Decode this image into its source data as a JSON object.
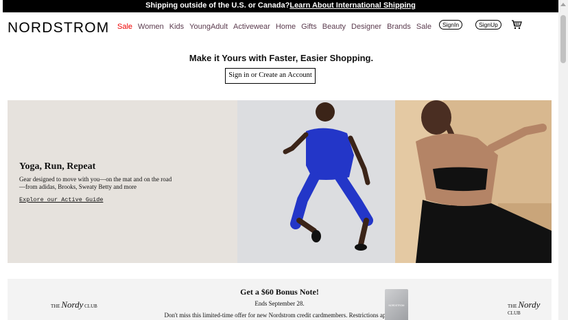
{
  "banner": {
    "text": "Shipping outside of the U.S. or Canada?",
    "link": "Learn About International Shipping"
  },
  "header": {
    "logo": "NORDSTROM",
    "nav": [
      "Sale",
      "Women",
      "Kids",
      "YoungAdult",
      "Activewear",
      "Home",
      "Gifts",
      "Beauty",
      "Designer",
      "Brands",
      "Sale"
    ],
    "signin": "SignIn",
    "signup": "SignUp",
    "cart_icon": "cart-icon"
  },
  "promo": {
    "title": "Make it Yours with Faster, Easier Shopping.",
    "button": "Sign in or Create an Account"
  },
  "hero": {
    "title": "Yoga, Run, Repeat",
    "description": "Gear designed to move with you—on the mat and on the road—from adidas, Brooks, Sweaty Betty and more",
    "link": "Explore our Active Guide"
  },
  "bonus": {
    "title": "Get a $60 Bonus Note!",
    "ends": "Ends September 28.",
    "description": "Don't miss this limited-time offer for new Nordstrom credit cardmembers. Restrictions apply.",
    "club_left": {
      "the": "THE",
      "script": "Nordy",
      "club": "CLUB"
    },
    "club_right": {
      "the": "THE",
      "script": "Nordy",
      "club": "CLUB"
    },
    "card_label": "NORDSTROM"
  },
  "colors": {
    "sale": "#ee0000",
    "nav": "#5b3b4e",
    "hero_bg": "#e6e2dd"
  }
}
